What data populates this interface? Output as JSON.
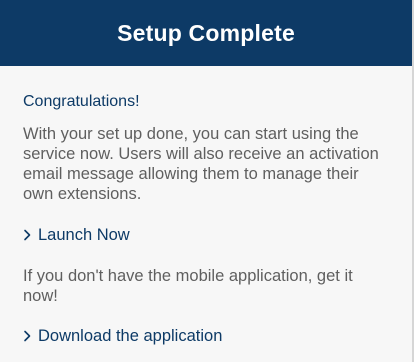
{
  "header": {
    "title": "Setup Complete"
  },
  "main": {
    "congrats": "Congratulations!",
    "intro": "With your set up done, you can start using the service now. Users will also receive an activation email message allowing them to manage their own extensions.",
    "launch_link": "Launch Now",
    "mobile_text": "If you don't have the mobile application, get it now!",
    "download_link": "Download the application"
  },
  "icons": {
    "launch_chevron": "chevron-right-icon",
    "download_chevron": "chevron-right-icon"
  },
  "colors": {
    "header_bg": "#0d3a66",
    "accent": "#0d3a66",
    "body_text": "#5f5f5f",
    "panel_bg": "#f7f7f7"
  }
}
